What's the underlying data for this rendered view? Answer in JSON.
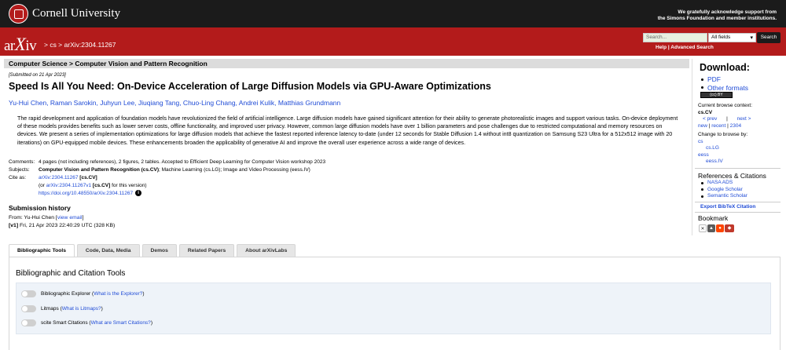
{
  "header": {
    "institution": "Cornell University",
    "acknowledgement_line1": "We gratefully acknowledge support from",
    "acknowledgement_line2": "the Simons Foundation and member institutions."
  },
  "nav": {
    "logo_prefix": "ar",
    "logo_x": "X",
    "logo_suffix": "iv",
    "breadcrumb": "> cs > arXiv:2304.11267",
    "search_placeholder": "Search...",
    "search_field_option": "All fields",
    "search_button": "Search",
    "help_link": "Help | Advanced Search"
  },
  "subject_header": "Computer Science > Computer Vision and Pattern Recognition",
  "paper": {
    "submitted": "[Submitted on 21 Apr 2023]",
    "title": "Speed Is All You Need: On-Device Acceleration of Large Diffusion Models via GPU-Aware Optimizations",
    "authors": "Yu-Hui Chen, Raman Sarokin, Juhyun Lee, Jiuqiang Tang, Chuo-Ling Chang, Andrei Kulik, Matthias Grundmann",
    "abstract": "The rapid development and application of foundation models have revolutionized the field of artificial intelligence. Large diffusion models have gained significant attention for their ability to generate photorealistic images and support various tasks. On-device deployment of these models provides benefits such as lower server costs, offline functionality, and improved user privacy. However, common large diffusion models have over 1 billion parameters and pose challenges due to restricted computational and memory resources on devices. We present a series of implementation optimizations for large diffusion models that achieve the fastest reported inference latency to-date (under 12 seconds for Stable Diffusion 1.4 without int8 quantization on Samsung S23 Ultra for a 512x512 image with 20 iterations) on GPU-equipped mobile devices. These enhancements broaden the applicability of generative AI and improve the overall user experience across a wide range of devices.",
    "comments_label": "Comments:",
    "comments": "4 pages (not including references), 2 figures, 2 tables. Accepted to Efficient Deep Learning for Computer Vision workshop 2023",
    "subjects_label": "Subjects:",
    "subjects_primary": "Computer Vision and Pattern Recognition (cs.CV)",
    "subjects_rest": "; Machine Learning (cs.LG); Image and Video Processing (eess.IV)",
    "cite_label": "Cite as:",
    "cite_id": "arXiv:2304.11267",
    "cite_cat": "[cs.CV]",
    "cite_alt_prefix": "(or ",
    "cite_alt_id": "arXiv:2304.11267v1",
    "cite_alt_cat": "[cs.CV]",
    "cite_alt_suffix": " for this version)",
    "doi": "https://doi.org/10.48550/arXiv.2304.11267",
    "info_glyph": "i"
  },
  "history": {
    "title": "Submission history",
    "from_prefix": "From: Yu-Hui Chen [",
    "view_email": "view email",
    "from_suffix": "]",
    "version": "[v1]",
    "version_text": " Fri, 21 Apr 2023 22:40:29 UTC (328 KB)"
  },
  "tabs": [
    {
      "label": "Bibliographic Tools"
    },
    {
      "label": "Code, Data, Media"
    },
    {
      "label": "Demos"
    },
    {
      "label": "Related Papers"
    },
    {
      "label": "About arXivLabs"
    }
  ],
  "panel": {
    "title": "Bibliographic and Citation Tools",
    "tools": [
      {
        "label": "Bibliographic Explorer (",
        "link": "What is the Explorer?",
        "end": ")"
      },
      {
        "label": "Litmaps (",
        "link": "What is Litmaps?",
        "end": ")"
      },
      {
        "label": "scite Smart Citations (",
        "link": "What are Smart Citations?",
        "end": ")"
      }
    ]
  },
  "sidebar": {
    "download_title": "Download:",
    "downloads": [
      "PDF",
      "Other formats"
    ],
    "license_text": "(cc) BY",
    "browse_context_label": "Current browse context:",
    "browse_context": "cs.CV",
    "prev": "< prev",
    "sep": "|",
    "next": "next >",
    "new": "new",
    "recent": "recent",
    "month": "2304",
    "pipe": " | ",
    "change_label": "Change to browse by:",
    "browse_cats": [
      "cs",
      "cs.LG",
      "eess",
      "eess.IV"
    ],
    "refs_title": "References & Citations",
    "refs": [
      "NASA ADS",
      "Google Scholar",
      "Semantic Scholar"
    ],
    "bibtex": "Export BibTeX Citation",
    "bookmark_title": "Bookmark"
  },
  "colors": {
    "arxiv_red": "#b31b1b",
    "link_blue": "#1f4bd6",
    "top_black": "#1b1b1b"
  }
}
